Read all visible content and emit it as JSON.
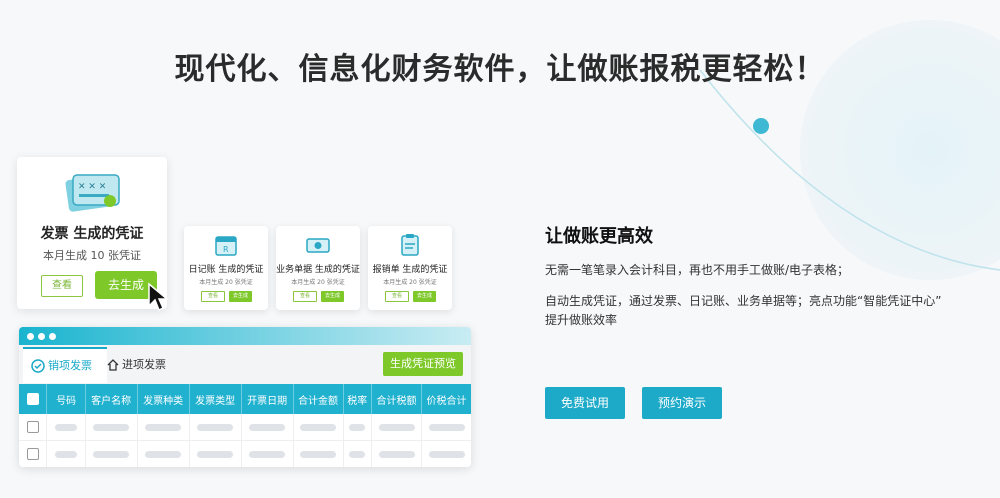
{
  "headline": "现代化、信息化财务软件，让做账报税更轻松！",
  "colors": {
    "accent_blue": "#1daac8",
    "accent_green": "#7ec82a"
  },
  "featured_card": {
    "title": "发票 生成的凭证",
    "subtitle": "本月生成 10 张凭证",
    "view_label": "查看",
    "generate_label": "去生成"
  },
  "small_cards": [
    {
      "title": "日记账 生成的凭证",
      "subtitle": "本月生成 20 张凭证",
      "view_label": "查看",
      "generate_label": "去生成"
    },
    {
      "title": "业务单据 生成的凭证",
      "subtitle": "本月生成 20 张凭证",
      "view_label": "查看",
      "generate_label": "去生成"
    },
    {
      "title": "报销单 生成的凭证",
      "subtitle": "本月生成 20 张凭证",
      "view_label": "查看",
      "generate_label": "去生成"
    }
  ],
  "invoice_window": {
    "tabs": [
      {
        "label": "销项发票"
      },
      {
        "label": "进项发票"
      }
    ],
    "preview_button": "生成凭证预览",
    "columns": [
      "号码",
      "客户名称",
      "发票种类",
      "发票类型",
      "开票日期",
      "合计金额",
      "税率",
      "合计税额",
      "价税合计"
    ]
  },
  "right_panel": {
    "title": "让做账更高效",
    "line1": "无需一笔笔录入会计科目，再也不用手工做账/电子表格；",
    "line2": "自动生成凭证，通过发票、日记账、业务单据等；亮点功能“智能凭证中心”",
    "line3": "提升做账效率",
    "trial_button": "免费试用",
    "demo_button": "预约演示"
  }
}
